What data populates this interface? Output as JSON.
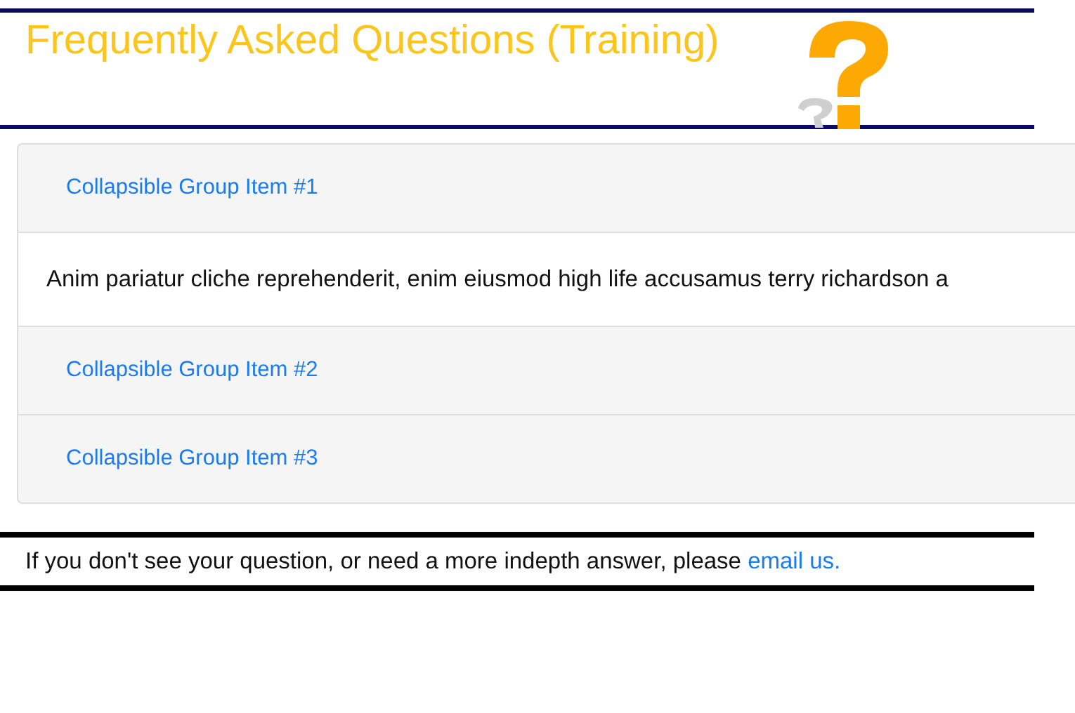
{
  "header": {
    "title": "Frequently Asked Questions (Training)"
  },
  "accordion": {
    "items": [
      {
        "title": "Collapsible Group Item #1",
        "expanded": true,
        "body": "Anim pariatur cliche reprehenderit, enim eiusmod high life accusamus terry richardson a"
      },
      {
        "title": "Collapsible Group Item #2",
        "expanded": false
      },
      {
        "title": "Collapsible Group Item #3",
        "expanded": false
      }
    ]
  },
  "footer": {
    "text": "If you don't see your question, or need a more indepth answer, please",
    "link": "email us."
  }
}
